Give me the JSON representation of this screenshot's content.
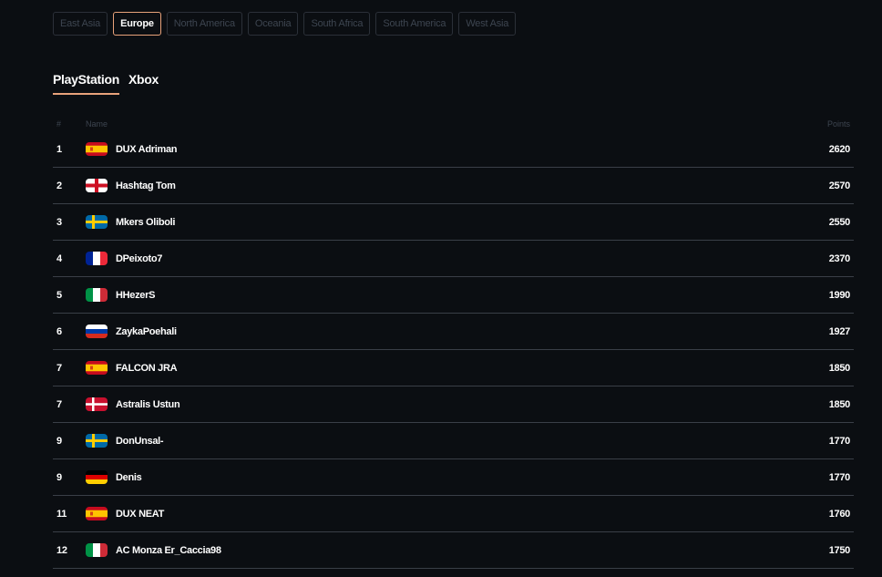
{
  "regions": [
    {
      "label": "East Asia",
      "active": false
    },
    {
      "label": "Europe",
      "active": true
    },
    {
      "label": "North America",
      "active": false
    },
    {
      "label": "Oceania",
      "active": false
    },
    {
      "label": "South Africa",
      "active": false
    },
    {
      "label": "South America",
      "active": false
    },
    {
      "label": "West Asia",
      "active": false
    }
  ],
  "platforms": [
    {
      "label": "PlayStation",
      "active": true
    },
    {
      "label": "Xbox",
      "active": false
    }
  ],
  "table": {
    "headers": {
      "rank": "#",
      "name": "Name",
      "points": "Points"
    },
    "rows": [
      {
        "rank": "1",
        "country": "spain",
        "name": "DUX Adriman",
        "points": "2620"
      },
      {
        "rank": "2",
        "country": "england",
        "name": "Hashtag Tom",
        "points": "2570"
      },
      {
        "rank": "3",
        "country": "sweden",
        "name": "Mkers Oliboli",
        "points": "2550"
      },
      {
        "rank": "4",
        "country": "france",
        "name": "DPeixoto7",
        "points": "2370"
      },
      {
        "rank": "5",
        "country": "italy",
        "name": "HHezerS",
        "points": "1990"
      },
      {
        "rank": "6",
        "country": "russia",
        "name": "ZaykaPoehali",
        "points": "1927"
      },
      {
        "rank": "7",
        "country": "spain",
        "name": "FALCON JRA",
        "points": "1850"
      },
      {
        "rank": "7",
        "country": "denmark",
        "name": "Astralis Ustun",
        "points": "1850"
      },
      {
        "rank": "9",
        "country": "sweden",
        "name": "DonUnsal-",
        "points": "1770"
      },
      {
        "rank": "9",
        "country": "germany",
        "name": "Denis",
        "points": "1770"
      },
      {
        "rank": "11",
        "country": "spain",
        "name": "DUX NEAT",
        "points": "1760"
      },
      {
        "rank": "12",
        "country": "italy",
        "name": "AC Monza Er_Caccia98",
        "points": "1750"
      }
    ]
  },
  "colors": {
    "accent": "#e8a27a",
    "background": "#0b0e12",
    "muted": "#3d4550"
  }
}
